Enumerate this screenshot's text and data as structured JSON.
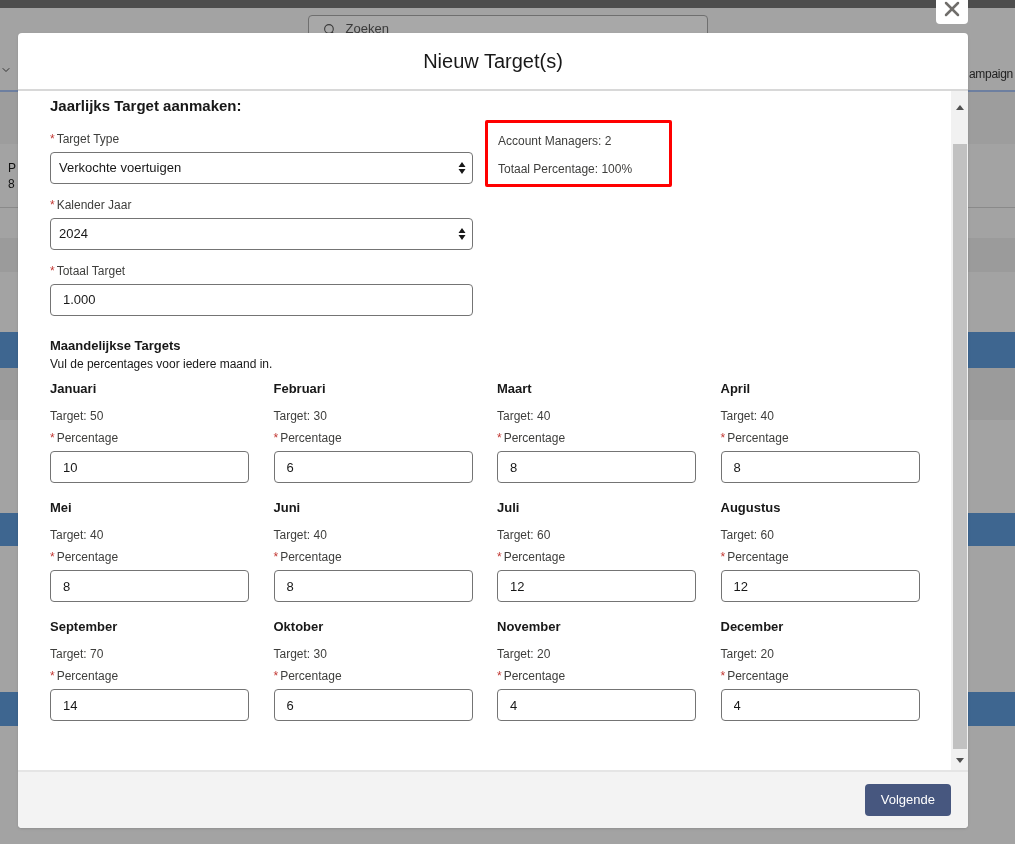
{
  "background": {
    "search": {
      "placeholder": "Zoeken"
    },
    "left_texts": [
      "P",
      "8"
    ],
    "right_text": "ampaign"
  },
  "dialog": {
    "title": "Nieuw Target(s)",
    "required_mark": "*",
    "heading": "Jaarlijks Target aanmaken:",
    "fields": [
      {
        "label": "Target Type",
        "required": true,
        "kind": "select",
        "value": "Verkochte voertuigen"
      },
      {
        "label": "Kalender Jaar",
        "required": true,
        "kind": "select",
        "value": "2024"
      },
      {
        "label": "Totaal Target",
        "required": true,
        "kind": "input",
        "value": "1.000"
      }
    ],
    "summary": {
      "highlighted": true,
      "lines": [
        "Account Managers: 2",
        "Totaal Percentage: 100%"
      ]
    },
    "monthly": {
      "title": "Maandelijkse Targets",
      "hint": "Vul de percentages voor iedere maand in.",
      "months": [
        {
          "name": "Januari",
          "target": "Target: 50",
          "label": "Percentage",
          "required": true,
          "value": "10"
        },
        {
          "name": "Februari",
          "target": "Target: 30",
          "label": "Percentage",
          "required": true,
          "value": "6"
        },
        {
          "name": "Maart",
          "target": "Target: 40",
          "label": "Percentage",
          "required": true,
          "value": "8"
        },
        {
          "name": "April",
          "target": "Target: 40",
          "label": "Percentage",
          "required": true,
          "value": "8"
        },
        {
          "name": "Mei",
          "target": "Target: 40",
          "label": "Percentage",
          "required": true,
          "value": "8"
        },
        {
          "name": "Juni",
          "target": "Target: 40",
          "label": "Percentage",
          "required": true,
          "value": "8"
        },
        {
          "name": "Juli",
          "target": "Target: 60",
          "label": "Percentage",
          "required": true,
          "value": "12"
        },
        {
          "name": "Augustus",
          "target": "Target: 60",
          "label": "Percentage",
          "required": true,
          "value": "12"
        },
        {
          "name": "September",
          "target": "Target: 70",
          "label": "Percentage",
          "required": true,
          "value": "14"
        },
        {
          "name": "Oktober",
          "target": "Target: 30",
          "label": "Percentage",
          "required": true,
          "value": "6"
        },
        {
          "name": "November",
          "target": "Target: 20",
          "label": "Percentage",
          "required": true,
          "value": "4"
        },
        {
          "name": "December",
          "target": "Target: 20",
          "label": "Percentage",
          "required": true,
          "value": "4"
        }
      ]
    },
    "buttons": [
      "Volgende"
    ]
  }
}
